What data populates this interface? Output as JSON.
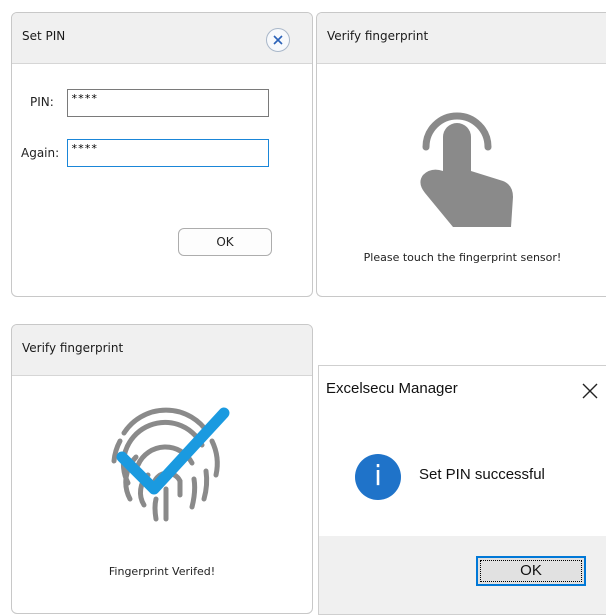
{
  "set_pin": {
    "title": "Set PIN",
    "pin_label": "PIN:",
    "pin_value": "****",
    "again_label": "Again:",
    "again_value": "****",
    "ok_label": "OK"
  },
  "verify_touch": {
    "title": "Verify fingerprint",
    "icon": "touch-hand-icon",
    "message": "Please touch the fingerprint sensor!"
  },
  "verify_done": {
    "title": "Verify fingerprint",
    "icon": "fingerprint-check-icon",
    "message": "Fingerprint Verifed!"
  },
  "message_box": {
    "title": "Excelsecu Manager",
    "icon": "info-icon",
    "icon_glyph": "i",
    "message": "Set PIN successful",
    "ok_label": "OK"
  },
  "colors": {
    "focus_border": "#1a86d8",
    "info_blue": "#1f73c9",
    "check_blue": "#1a9ae0",
    "icon_gray": "#8a8a8a"
  }
}
